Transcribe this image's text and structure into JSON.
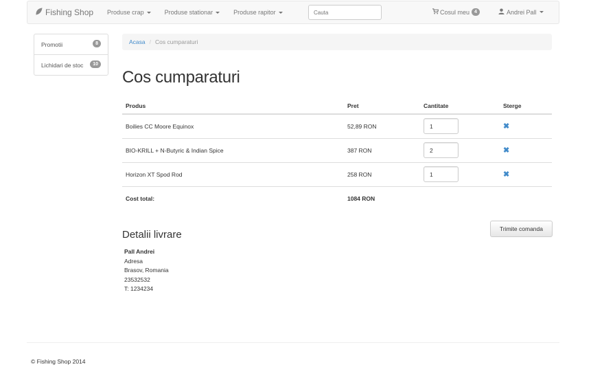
{
  "navbar": {
    "brand": "Fishing Shop",
    "menus": [
      "Produse crap",
      "Produse stationar",
      "Produse rapitor"
    ],
    "search_placeholder": "Cauta",
    "cart_label": "Cosul meu",
    "cart_count": "4",
    "user_name": "Andrei Pall"
  },
  "sidebar": {
    "items": [
      {
        "label": "Promotii",
        "count": "8"
      },
      {
        "label": "Lichidari de stoc",
        "count": "10"
      }
    ]
  },
  "breadcrumb": {
    "home": "Acasa",
    "current": "Cos cumparaturi"
  },
  "page_title": "Cos cumparaturi",
  "table": {
    "headers": {
      "product": "Produs",
      "price": "Pret",
      "quantity": "Cantitate",
      "remove": "Sterge"
    },
    "rows": [
      {
        "product": "Boilies CC Moore Equinox",
        "price": "52,89 RON",
        "quantity": "1"
      },
      {
        "product": "BIO-KRILL + N-Butyric & Indian Spice",
        "price": "387 RON",
        "quantity": "2"
      },
      {
        "product": "Horizon XT Spod Rod",
        "price": "258 RON",
        "quantity": "1"
      }
    ],
    "total_label": "Cost total:",
    "total_value": "1084 RON"
  },
  "submit_label": "Trimite comanda",
  "delivery": {
    "title": "Detalii livrare",
    "name": "Pall Andrei",
    "address": "Adresa",
    "city": "Brasov, Romania",
    "zip": "23532532",
    "phone": "T: 1234234"
  },
  "footer": "© Fishing Shop 2014"
}
